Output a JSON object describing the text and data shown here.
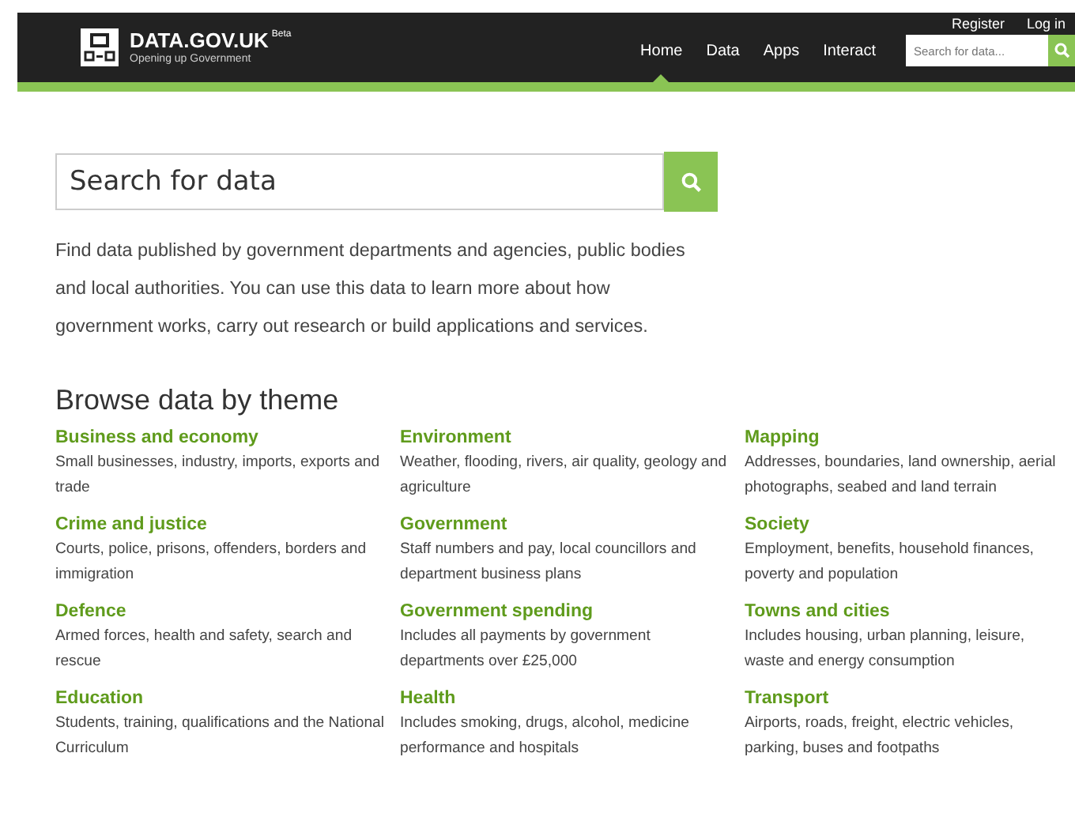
{
  "header": {
    "logo_title": "DATA.GOV.UK",
    "logo_badge": "Beta",
    "logo_subtitle": "Opening up Government",
    "top_links": [
      "Register",
      "Log in"
    ],
    "nav": [
      {
        "label": "Home",
        "selected": true
      },
      {
        "label": "Data",
        "selected": false
      },
      {
        "label": "Apps",
        "selected": false
      },
      {
        "label": "Interact",
        "selected": false
      }
    ],
    "search": {
      "placeholder": "Search for data..."
    }
  },
  "main_search": {
    "placeholder": "Search for data"
  },
  "intro": "Find data published by government departments and agencies, public bodies and local authorities. You can use this data to learn more about how government works, carry out research or build applications and services.",
  "themes_heading": "Browse data by theme",
  "themes": [
    {
      "title": "Business and economy",
      "description": "Small businesses, industry, imports, exports and trade"
    },
    {
      "title": "Environment",
      "description": "Weather, flooding, rivers, air quality, geology and agriculture"
    },
    {
      "title": "Mapping",
      "description": "Addresses, boundaries, land ownership, aerial photographs, seabed and land terrain"
    },
    {
      "title": "Crime and justice",
      "description": "Courts, police, prisons, offenders, borders and immigration"
    },
    {
      "title": "Government",
      "description": "Staff numbers and pay, local councillors and department business plans"
    },
    {
      "title": "Society",
      "description": "Employment, benefits, household finances, poverty and population"
    },
    {
      "title": "Defence",
      "description": "Armed forces, health and safety, search and rescue"
    },
    {
      "title": "Government spending",
      "description": "Includes all payments by government departments over £25,000"
    },
    {
      "title": "Towns and cities",
      "description": "Includes housing, urban planning, leisure, waste and energy consumption"
    },
    {
      "title": "Education",
      "description": "Students, training, qualifications and the National Curriculum"
    },
    {
      "title": "Health",
      "description": "Includes smoking, drugs, alcohol, medicine performance and hospitals"
    },
    {
      "title": "Transport",
      "description": "Airports, roads, freight, electric vehicles, parking, buses and footpaths"
    }
  ]
}
